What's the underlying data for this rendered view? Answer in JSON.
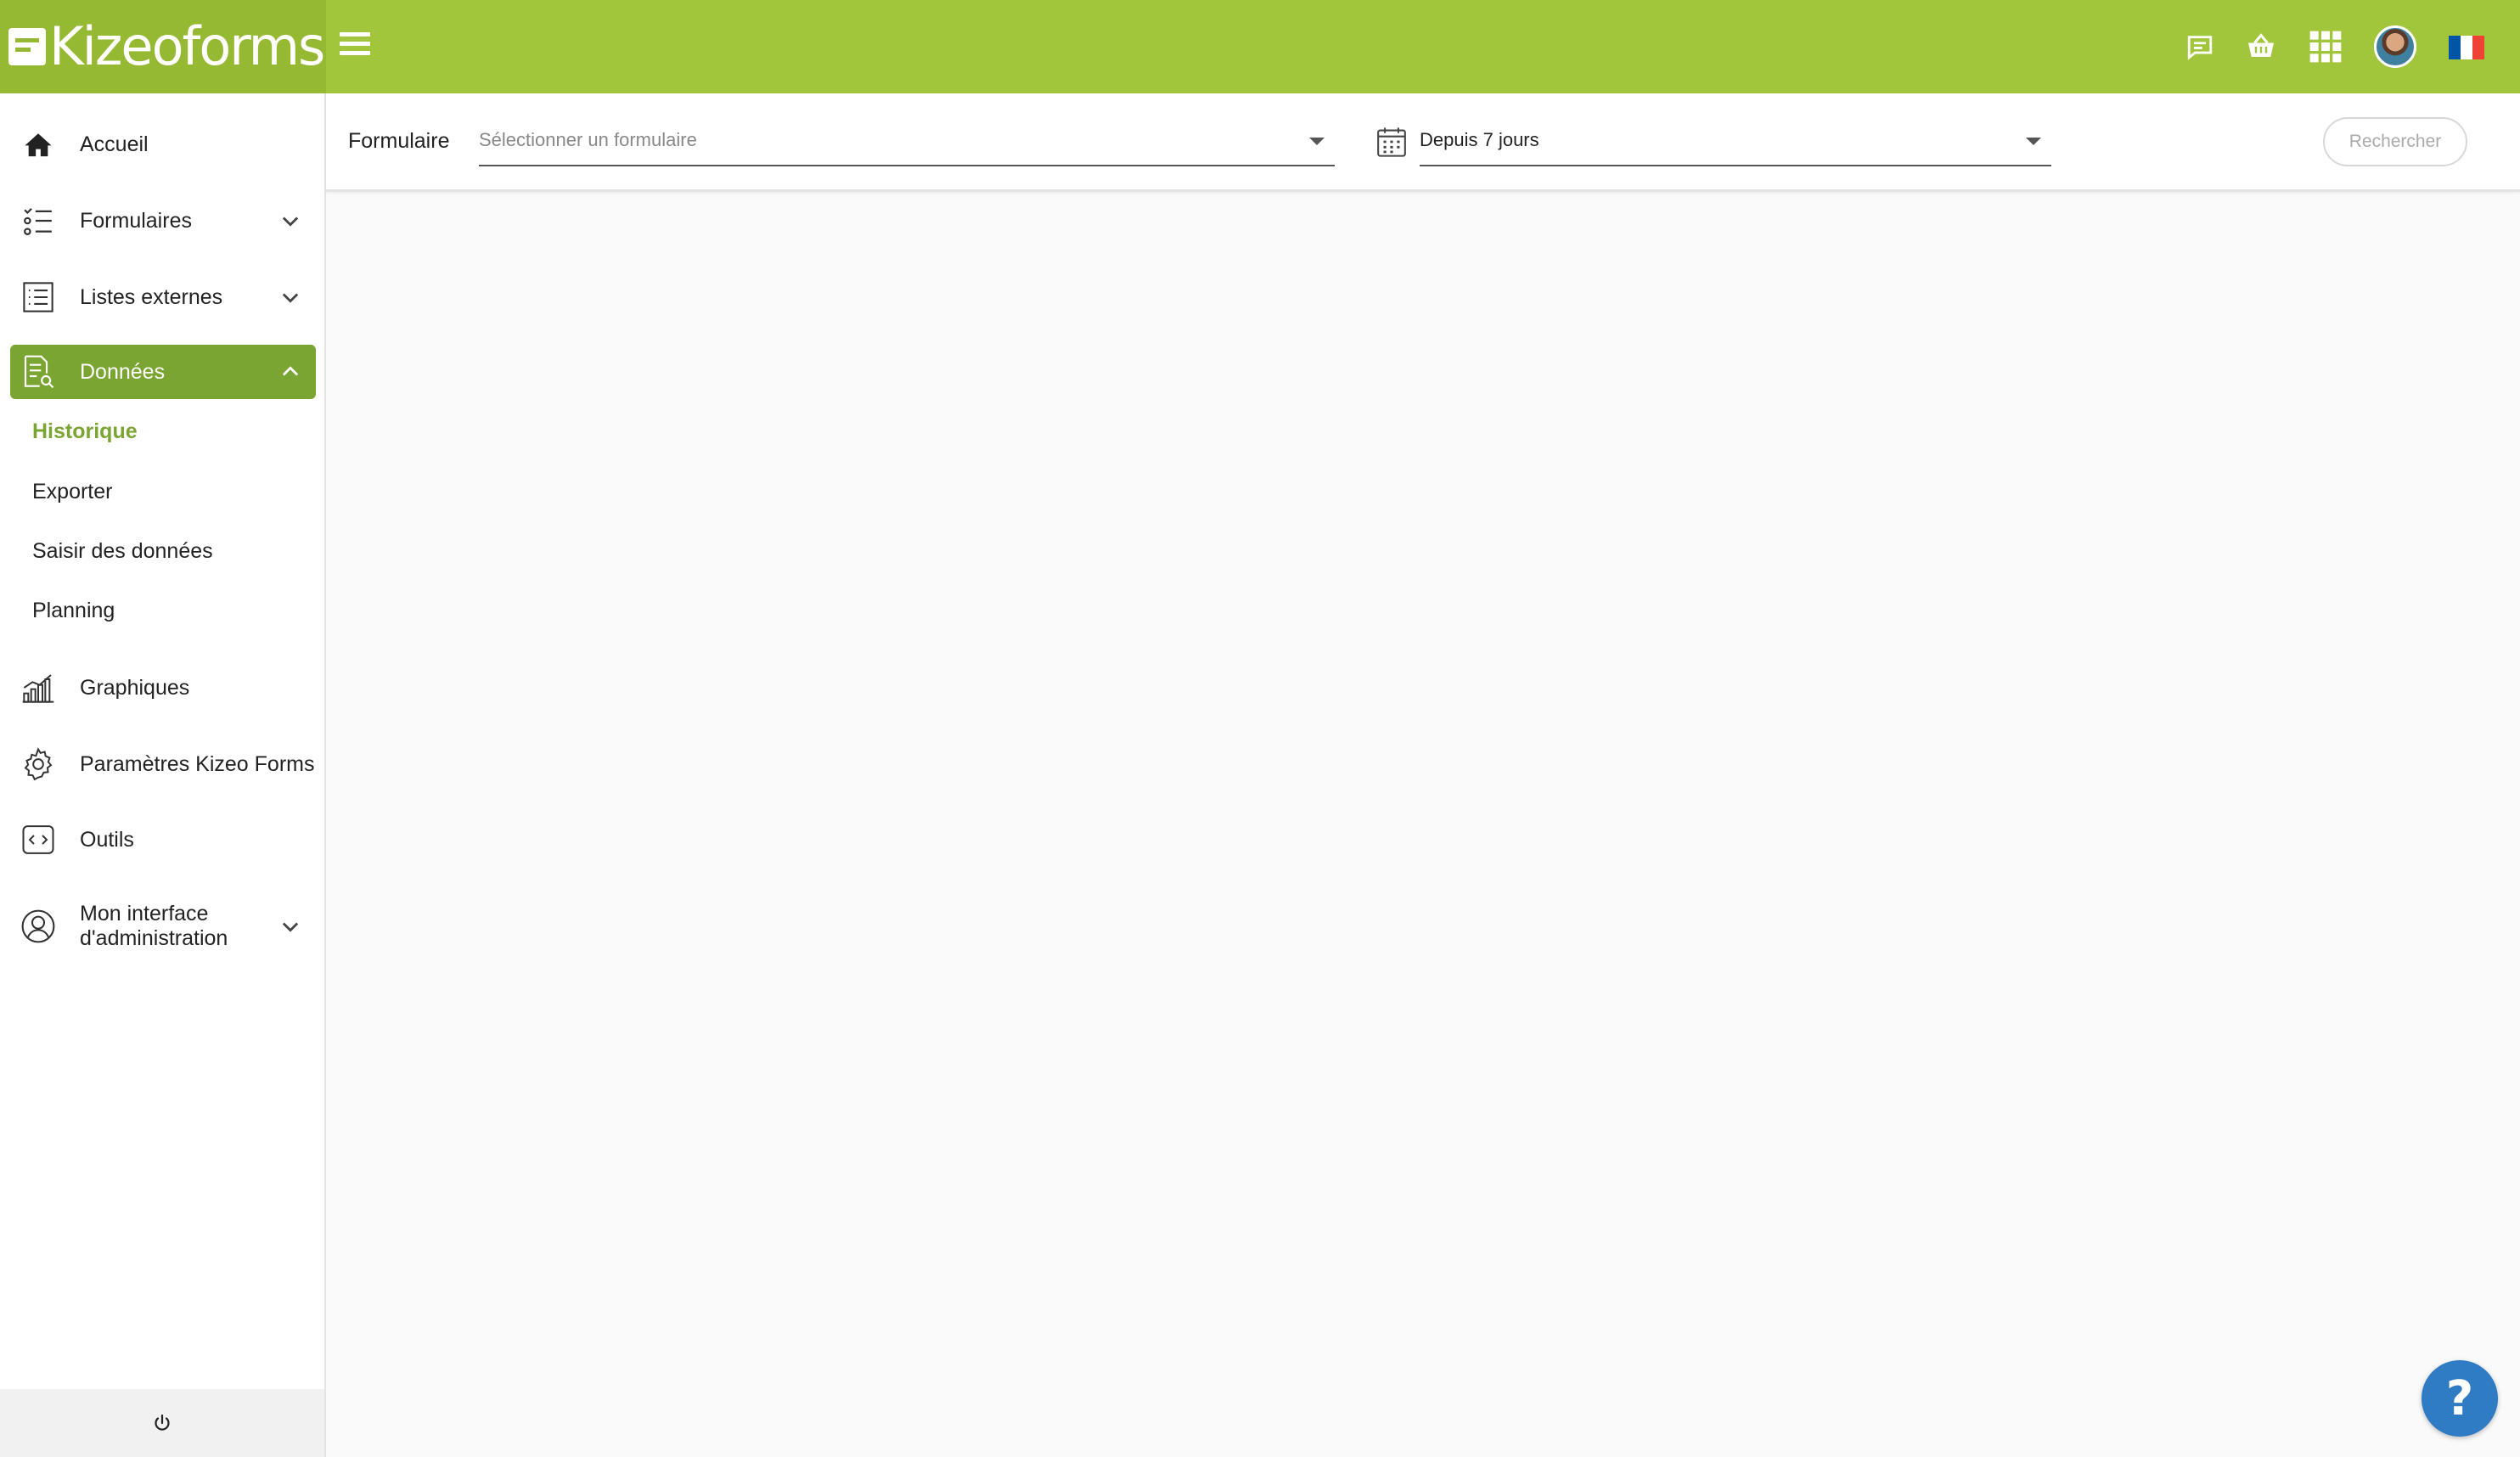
{
  "app": {
    "logo_text": "Kizeoforms"
  },
  "header": {
    "icons": [
      "chat-icon",
      "basket-icon",
      "apps-grid-icon",
      "user-avatar",
      "french-flag"
    ],
    "colors": {
      "topbar": "#a2c63b",
      "logo_bg": "#96b934",
      "flag": [
        "#0055a4",
        "#ffffff",
        "#ef4135"
      ]
    }
  },
  "sidebar": {
    "items": [
      {
        "label": "Accueil",
        "icon": "home-icon"
      },
      {
        "label": "Formulaires",
        "icon": "form-list-icon",
        "expandable": true
      },
      {
        "label": "Listes externes",
        "icon": "list-icon",
        "expandable": true
      },
      {
        "label": "Données",
        "icon": "data-search-icon",
        "expandable": true,
        "active": true
      },
      {
        "label": "Graphiques",
        "icon": "chart-icon"
      },
      {
        "label": "Paramètres Kizeo Forms",
        "icon": "gear-icon"
      },
      {
        "label": "Outils",
        "icon": "code-icon"
      },
      {
        "label": "Mon interface d'administration",
        "icon": "user-circle-icon",
        "expandable": true
      }
    ],
    "subitems": [
      {
        "label": "Historique",
        "current": true
      },
      {
        "label": "Exporter"
      },
      {
        "label": "Saisir des données"
      },
      {
        "label": "Planning"
      }
    ],
    "accent_color": "#7aa532"
  },
  "filters": {
    "form_label": "Formulaire",
    "form_placeholder": "Sélectionner un formulaire",
    "period_value": "Depuis 7 jours",
    "search_button": "Rechercher"
  },
  "help": {
    "label": "?",
    "color": "#2f7bc4"
  }
}
